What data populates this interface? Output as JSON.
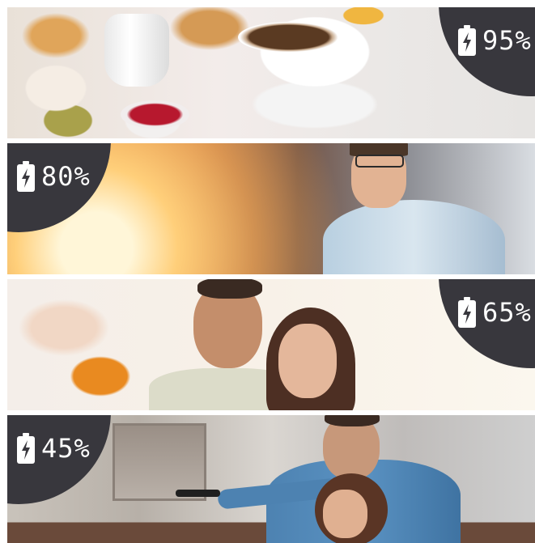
{
  "panels": [
    {
      "scene": "breakfast",
      "badge_side": "right",
      "battery_percent": "95%",
      "icon": "battery-charging-icon"
    },
    {
      "scene": "man-at-window",
      "badge_side": "left",
      "battery_percent": "80%",
      "icon": "battery-charging-icon"
    },
    {
      "scene": "couple-laughing",
      "badge_side": "right",
      "battery_percent": "65%",
      "icon": "battery-charging-icon"
    },
    {
      "scene": "couple-watching-tv",
      "badge_side": "left",
      "battery_percent": "45%",
      "icon": "battery-charging-icon"
    }
  ],
  "colors": {
    "badge": "#38373d",
    "text": "#ffffff"
  }
}
